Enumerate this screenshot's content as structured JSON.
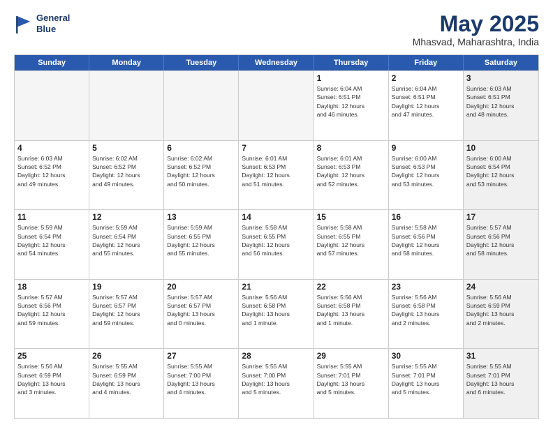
{
  "header": {
    "logo_line1": "General",
    "logo_line2": "Blue",
    "month": "May 2025",
    "location": "Mhasvad, Maharashtra, India"
  },
  "weekdays": [
    "Sunday",
    "Monday",
    "Tuesday",
    "Wednesday",
    "Thursday",
    "Friday",
    "Saturday"
  ],
  "rows": [
    [
      {
        "day": "",
        "info": "",
        "empty": true
      },
      {
        "day": "",
        "info": "",
        "empty": true
      },
      {
        "day": "",
        "info": "",
        "empty": true
      },
      {
        "day": "",
        "info": "",
        "empty": true
      },
      {
        "day": "1",
        "info": "Sunrise: 6:04 AM\nSunset: 6:51 PM\nDaylight: 12 hours\nand 46 minutes."
      },
      {
        "day": "2",
        "info": "Sunrise: 6:04 AM\nSunset: 6:51 PM\nDaylight: 12 hours\nand 47 minutes."
      },
      {
        "day": "3",
        "info": "Sunrise: 6:03 AM\nSunset: 6:51 PM\nDaylight: 12 hours\nand 48 minutes.",
        "shaded": true
      }
    ],
    [
      {
        "day": "4",
        "info": "Sunrise: 6:03 AM\nSunset: 6:52 PM\nDaylight: 12 hours\nand 49 minutes."
      },
      {
        "day": "5",
        "info": "Sunrise: 6:02 AM\nSunset: 6:52 PM\nDaylight: 12 hours\nand 49 minutes."
      },
      {
        "day": "6",
        "info": "Sunrise: 6:02 AM\nSunset: 6:52 PM\nDaylight: 12 hours\nand 50 minutes."
      },
      {
        "day": "7",
        "info": "Sunrise: 6:01 AM\nSunset: 6:53 PM\nDaylight: 12 hours\nand 51 minutes."
      },
      {
        "day": "8",
        "info": "Sunrise: 6:01 AM\nSunset: 6:53 PM\nDaylight: 12 hours\nand 52 minutes."
      },
      {
        "day": "9",
        "info": "Sunrise: 6:00 AM\nSunset: 6:53 PM\nDaylight: 12 hours\nand 53 minutes."
      },
      {
        "day": "10",
        "info": "Sunrise: 6:00 AM\nSunset: 6:54 PM\nDaylight: 12 hours\nand 53 minutes.",
        "shaded": true
      }
    ],
    [
      {
        "day": "11",
        "info": "Sunrise: 5:59 AM\nSunset: 6:54 PM\nDaylight: 12 hours\nand 54 minutes."
      },
      {
        "day": "12",
        "info": "Sunrise: 5:59 AM\nSunset: 6:54 PM\nDaylight: 12 hours\nand 55 minutes."
      },
      {
        "day": "13",
        "info": "Sunrise: 5:59 AM\nSunset: 6:55 PM\nDaylight: 12 hours\nand 55 minutes."
      },
      {
        "day": "14",
        "info": "Sunrise: 5:58 AM\nSunset: 6:55 PM\nDaylight: 12 hours\nand 56 minutes."
      },
      {
        "day": "15",
        "info": "Sunrise: 5:58 AM\nSunset: 6:55 PM\nDaylight: 12 hours\nand 57 minutes."
      },
      {
        "day": "16",
        "info": "Sunrise: 5:58 AM\nSunset: 6:56 PM\nDaylight: 12 hours\nand 58 minutes."
      },
      {
        "day": "17",
        "info": "Sunrise: 5:57 AM\nSunset: 6:56 PM\nDaylight: 12 hours\nand 58 minutes.",
        "shaded": true
      }
    ],
    [
      {
        "day": "18",
        "info": "Sunrise: 5:57 AM\nSunset: 6:56 PM\nDaylight: 12 hours\nand 59 minutes."
      },
      {
        "day": "19",
        "info": "Sunrise: 5:57 AM\nSunset: 6:57 PM\nDaylight: 12 hours\nand 59 minutes."
      },
      {
        "day": "20",
        "info": "Sunrise: 5:57 AM\nSunset: 6:57 PM\nDaylight: 13 hours\nand 0 minutes."
      },
      {
        "day": "21",
        "info": "Sunrise: 5:56 AM\nSunset: 6:58 PM\nDaylight: 13 hours\nand 1 minute."
      },
      {
        "day": "22",
        "info": "Sunrise: 5:56 AM\nSunset: 6:58 PM\nDaylight: 13 hours\nand 1 minute."
      },
      {
        "day": "23",
        "info": "Sunrise: 5:56 AM\nSunset: 6:58 PM\nDaylight: 13 hours\nand 2 minutes."
      },
      {
        "day": "24",
        "info": "Sunrise: 5:56 AM\nSunset: 6:59 PM\nDaylight: 13 hours\nand 2 minutes.",
        "shaded": true
      }
    ],
    [
      {
        "day": "25",
        "info": "Sunrise: 5:56 AM\nSunset: 6:59 PM\nDaylight: 13 hours\nand 3 minutes."
      },
      {
        "day": "26",
        "info": "Sunrise: 5:55 AM\nSunset: 6:59 PM\nDaylight: 13 hours\nand 4 minutes."
      },
      {
        "day": "27",
        "info": "Sunrise: 5:55 AM\nSunset: 7:00 PM\nDaylight: 13 hours\nand 4 minutes."
      },
      {
        "day": "28",
        "info": "Sunrise: 5:55 AM\nSunset: 7:00 PM\nDaylight: 13 hours\nand 5 minutes."
      },
      {
        "day": "29",
        "info": "Sunrise: 5:55 AM\nSunset: 7:01 PM\nDaylight: 13 hours\nand 5 minutes."
      },
      {
        "day": "30",
        "info": "Sunrise: 5:55 AM\nSunset: 7:01 PM\nDaylight: 13 hours\nand 5 minutes."
      },
      {
        "day": "31",
        "info": "Sunrise: 5:55 AM\nSunset: 7:01 PM\nDaylight: 13 hours\nand 6 minutes.",
        "shaded": true
      }
    ]
  ]
}
